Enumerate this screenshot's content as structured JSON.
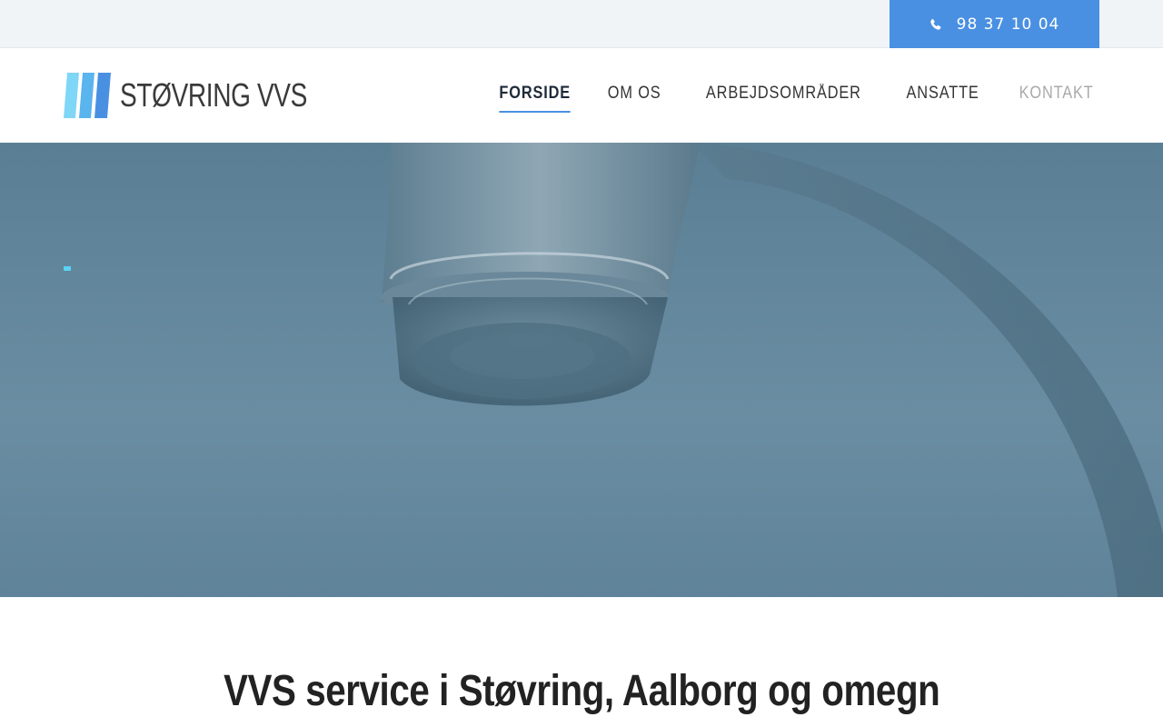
{
  "topbar": {
    "phone": "98 37 10 04",
    "phone_icon": "phone-icon"
  },
  "header": {
    "logo_text": "STØVRING VVS",
    "logo_colors": [
      "#7fd6f7",
      "#5ab4ee",
      "#4a90e2"
    ],
    "nav": [
      {
        "label": "FORSIDE",
        "state": "active"
      },
      {
        "label": "OM OS",
        "state": "normal"
      },
      {
        "label": "ARBEJDSOMRÅDER",
        "state": "normal"
      },
      {
        "label": "ANSATTE",
        "state": "normal"
      },
      {
        "label": "KONTAKT",
        "state": "muted"
      }
    ]
  },
  "hero": {
    "image": "faucet-closeup",
    "slide_indicator_color": "#5ad2f4"
  },
  "main": {
    "headline": "VVS service i Støvring, Aalborg og omegn"
  },
  "colors": {
    "accent": "#4a90e2",
    "topbar_bg": "#f0f4f7",
    "hero_tint": "#5f8399"
  }
}
